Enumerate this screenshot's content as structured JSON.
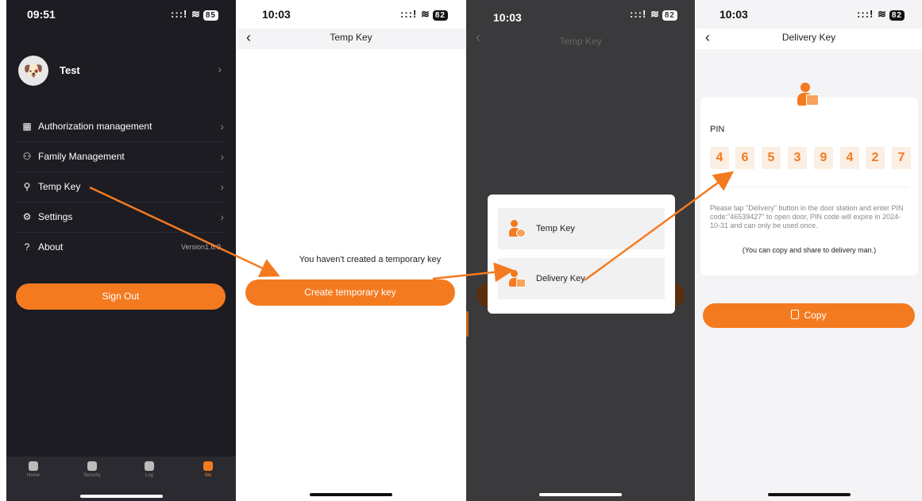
{
  "panel1": {
    "time": "09:51",
    "battery": "85",
    "user_name": "Test",
    "menu": [
      {
        "icon": "grid-icon",
        "label": "Authorization management"
      },
      {
        "icon": "family-icon",
        "label": "Family Management"
      },
      {
        "icon": "key-icon",
        "label": "Temp Key"
      },
      {
        "icon": "gear-icon",
        "label": "Settings"
      },
      {
        "icon": "question-icon",
        "label": "About",
        "value": "Version1.6.9"
      }
    ],
    "sign_out": "Sign Out",
    "tabs": [
      {
        "icon": "home-icon",
        "label": "Home"
      },
      {
        "icon": "shield-icon",
        "label": "Security"
      },
      {
        "icon": "log-icon",
        "label": "Log"
      },
      {
        "icon": "me-icon",
        "label": "Me"
      }
    ]
  },
  "panel2": {
    "time": "10:03",
    "battery": "82",
    "title": "Temp Key",
    "empty_text": "You haven't created a temporary key",
    "create_button": "Create temporary key"
  },
  "panel3": {
    "time": "10:03",
    "battery": "82",
    "title": "Temp Key",
    "options": [
      {
        "icon": "temp-key-icon",
        "label": "Temp Key"
      },
      {
        "icon": "delivery-icon",
        "label": "Delivery Key"
      }
    ]
  },
  "panel4": {
    "time": "10:03",
    "battery": "82",
    "title": "Delivery Key",
    "pin_label": "PIN",
    "pin_digits": [
      "4",
      "6",
      "5",
      "3",
      "9",
      "4",
      "2",
      "7"
    ],
    "instructions": "Please tap \"Delivery\" button in the door station and enter PIN code:\"46539427\" to open door, PIN code will expire in 2024-10-31 and can only be used once.",
    "share_note": "(You can copy and share to delivery man.)",
    "copy_button": "Copy"
  },
  "colors": {
    "accent": "#f47a20",
    "dark_bg": "#1c1c22"
  }
}
